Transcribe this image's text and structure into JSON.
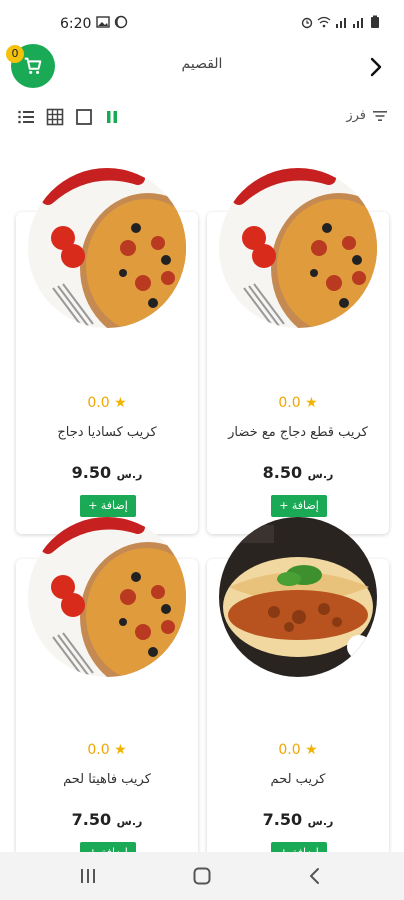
{
  "status_bar": {
    "time": "6:20",
    "left_icons": [
      "image-icon",
      "moon-icon"
    ],
    "right_icons": [
      "alarm-icon",
      "wifi-icon",
      "signal-icon",
      "signal-icon",
      "battery-icon"
    ]
  },
  "header": {
    "title": "القصيم",
    "cart_count": "0",
    "cart_icon": "cart-icon",
    "back_icon": "chevron-right-icon"
  },
  "toolbar": {
    "sort_label": "فرز",
    "views": [
      "list-view-icon",
      "grid-view-icon",
      "single-view-icon",
      "two-column-view-icon"
    ],
    "active_view": "two-column-view-icon"
  },
  "products": [
    {
      "name": "كريب قطع دجاج مع خضار",
      "rating": "0.0",
      "price": "8.50",
      "currency": "ر.س",
      "add_label": "+ إضافة",
      "image": "pizza"
    },
    {
      "name": "كريب كساديا دجاج",
      "rating": "0.0",
      "price": "9.50",
      "currency": "ر.س",
      "add_label": "+ إضافة",
      "image": "pizza"
    },
    {
      "name": "كريب لحم",
      "rating": "0.0",
      "price": "7.50",
      "currency": "ر.س",
      "add_label": "+ إضافة",
      "image": "pasta"
    },
    {
      "name": "كريب فاهيتا لحم",
      "rating": "0.0",
      "price": "7.50",
      "currency": "ر.س",
      "add_label": "+ إضافة",
      "image": "pizza"
    }
  ],
  "colors": {
    "accent": "#1aaa55",
    "badge": "#f4c20d",
    "star": "#f0b400"
  },
  "nav_bar": {
    "icons": [
      "recent-apps-icon",
      "home-icon",
      "back-icon"
    ]
  }
}
